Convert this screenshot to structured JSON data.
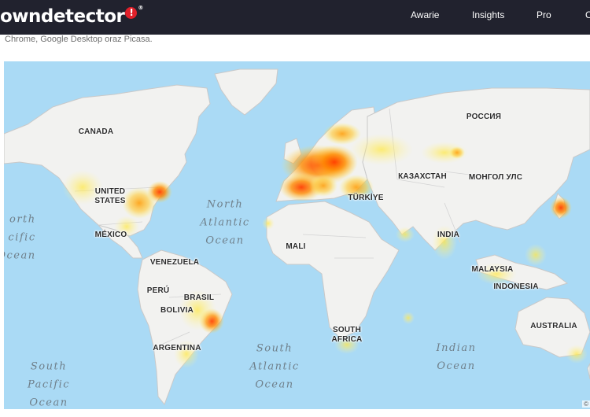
{
  "header": {
    "logo_text": "owndetector",
    "logo_badge": "!",
    "logo_reg": "®",
    "nav": [
      "Awarie",
      "Insights",
      "Pro",
      "C"
    ]
  },
  "subtitle": "Chrome, Google Desktop oraz Picasa.",
  "map": {
    "countries": {
      "canada": "CANADA",
      "usa": "UNITED\nSTATES",
      "mexico": "MÉXICO",
      "venezuela": "VENEZUELA",
      "peru": "PERÚ",
      "brasil": "BRASIL",
      "bolivia": "BOLIVIA",
      "argentina": "ARGENTINA",
      "russia": "РОССИЯ",
      "kazakhstan": "КАЗАХСТАН",
      "mongolia": "МОНГОЛ УЛС",
      "turkiye": "TÜRKİYE",
      "mali": "MALI",
      "india": "INDIA",
      "malaysia": "MALAYSIA",
      "indonesia": "INDONESIA",
      "australia": "AUSTRALIA",
      "south_africa": "SOUTH\nAFRICA"
    },
    "oceans": {
      "north_atlantic": "North\nAtlantic\nOcean",
      "north_pacific": "orth\ncific\nOcean",
      "south_atlantic": "South\nAtlantic\nOcean",
      "south_pacific": "South\nPacific\nOcean",
      "indian": "Indian\nOcean"
    },
    "attribution": "©",
    "colors": {
      "water": "#aadaf5",
      "land": "#f2f2f0",
      "border": "#c9c9c9",
      "heat_high": "#ff4a00",
      "heat_mid": "#ff9a00",
      "heat_low": "#ffe44a"
    }
  }
}
